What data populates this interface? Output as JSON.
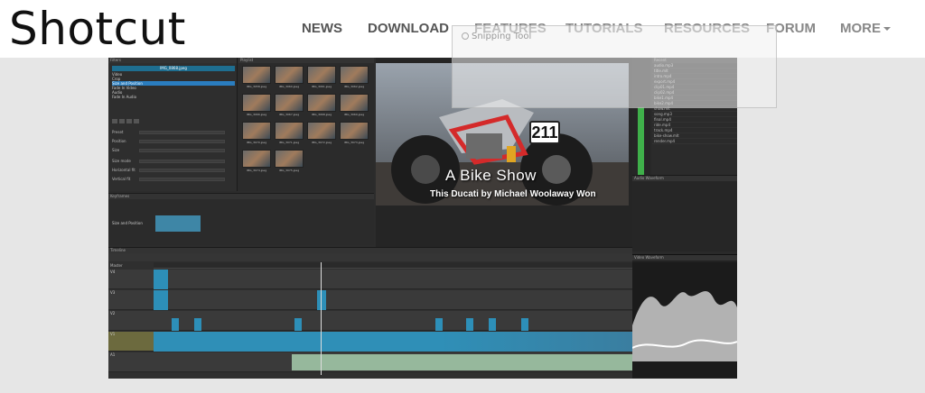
{
  "site": {
    "logo": "Shotcut",
    "nav": {
      "news": "NEWS",
      "download": "DOWNLOAD",
      "features": "FEATURES",
      "tutorials": "TUTORIALS",
      "resources": "RESOURCES",
      "forum": "FORUM",
      "more": "MORE"
    }
  },
  "overlay": {
    "snipping_tool": "Snipping Tool"
  },
  "app": {
    "filters": {
      "header": "Filters",
      "selected_clip": "IMG_0868.jpeg",
      "items": [
        "Video",
        "Crop",
        "Size and Position",
        "Fade In Video",
        "Audio",
        "Fade In Audio"
      ],
      "props": [
        "Preset",
        "Position",
        "Size",
        "Size mode",
        "Horizontal fit",
        "Vertical fit"
      ]
    },
    "playlist": {
      "header": "Playlist",
      "thumbs": [
        "IMG_3058.jpeg",
        "IMG_3060.jpeg",
        "IMG_3061.jpeg",
        "IMG_3062.jpeg",
        "IMG_3066.jpeg",
        "IMG_3067.jpeg",
        "IMG_3068.jpeg",
        "IMG_3069.jpeg",
        "IMG_3070.jpeg",
        "IMG_3071.jpeg",
        "IMG_3072.jpeg",
        "IMG_3073.jpeg",
        "IMG_3074.jpeg",
        "IMG_3075.jpeg"
      ]
    },
    "player": {
      "title": "A Bike Show",
      "subtitle": "This Ducati by Michael Woolaway Won",
      "plate": "211"
    },
    "keyframes": {
      "header": "Keyframes",
      "track": "Size and Position"
    },
    "timeline": {
      "header": "Timeline",
      "master": "Master",
      "tracks": [
        "V4",
        "V3",
        "V2",
        "V1",
        "A1"
      ]
    },
    "recent": {
      "header": "Recent",
      "items": [
        "audio.mp3",
        "title.mlt",
        "intro.mp4",
        "export.mp4",
        "clip01.mp4",
        "clip02.mp4",
        "bike1.mp4",
        "bike2.mp4",
        "show.mlt",
        "song.mp3",
        "final.mp4",
        "ride.mp4",
        "track.mp4",
        "bike-show.mlt",
        "render.mp4"
      ]
    },
    "scopes": {
      "audio_waveform": "Audio Waveform",
      "video_waveform": "Video Waveform"
    }
  }
}
